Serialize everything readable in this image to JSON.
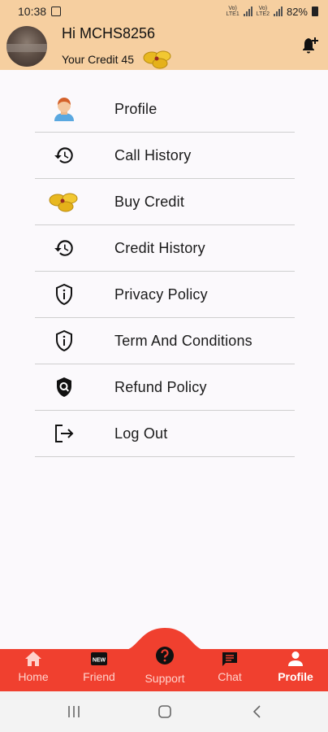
{
  "status_bar": {
    "time": "10:38",
    "battery": "82%",
    "sim1": "Vo) LTE1",
    "sim2": "Vo) LTE2"
  },
  "header": {
    "greeting": "Hi MCHS8256",
    "credit_text": "Your Credit 45"
  },
  "menu": {
    "items": [
      {
        "label": "Profile",
        "icon": "person-avatar-icon"
      },
      {
        "label": "Call History",
        "icon": "history-icon"
      },
      {
        "label": "Buy Credit",
        "icon": "coins-icon"
      },
      {
        "label": "Credit History",
        "icon": "history-icon"
      },
      {
        "label": "Privacy Policy",
        "icon": "info-shield-icon"
      },
      {
        "label": "Term And Conditions",
        "icon": "info-shield-icon"
      },
      {
        "label": "Refund Policy",
        "icon": "search-shield-icon"
      },
      {
        "label": "Log Out",
        "icon": "logout-icon"
      }
    ]
  },
  "bottom_nav": {
    "items": [
      {
        "label": "Home",
        "icon": "home-icon"
      },
      {
        "label": "Friend",
        "icon": "new-badge-icon"
      },
      {
        "label": "Support",
        "icon": "help-circle-icon"
      },
      {
        "label": "Chat",
        "icon": "chat-icon"
      },
      {
        "label": "Profile",
        "icon": "person-icon"
      }
    ],
    "active": "Profile",
    "new_badge": "NEW"
  },
  "colors": {
    "header_bg": "#f6cfa0",
    "nav_bg": "#f0402f",
    "page_bg": "#fbf9fc"
  }
}
